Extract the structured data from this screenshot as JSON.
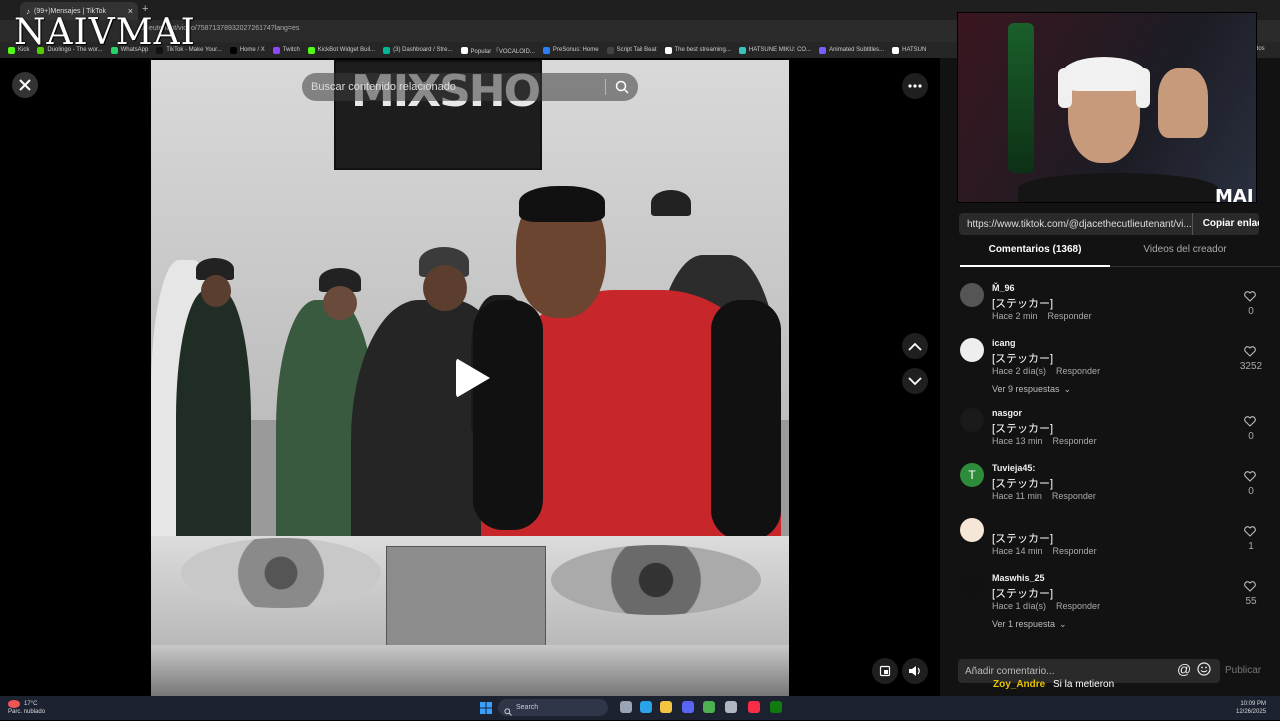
{
  "browser": {
    "tab_title": "(99+)Mensajes | TikTok",
    "new_tab": "+",
    "url": "utlieutenant/video/7587137893202726174?lang=es",
    "bookmarks": [
      {
        "label": "Kick",
        "color": "#53fc18"
      },
      {
        "label": "Duolingo - The wor...",
        "color": "#58cc02"
      },
      {
        "label": "WhatsApp",
        "color": "#25d366"
      },
      {
        "label": "TikTok - Make Your...",
        "color": "#111111"
      },
      {
        "label": "Home / X",
        "color": "#000000"
      },
      {
        "label": "Twitch",
        "color": "#9146ff"
      },
      {
        "label": "KickBot Widget Buil...",
        "color": "#53fc18"
      },
      {
        "label": "(3) Dashboard / Stre...",
        "color": "#00b894"
      },
      {
        "label": "Popular 「VOCALOID...",
        "color": "#ffffff"
      },
      {
        "label": "PreSonus: Home",
        "color": "#2d7ff9"
      },
      {
        "label": "Script Tail Beat",
        "color": "#444444"
      },
      {
        "label": "The best streaming...",
        "color": "#ffffff"
      },
      {
        "label": "HATSUNE MIKU: CO...",
        "color": "#39c5bb"
      },
      {
        "label": "Animated Subtitles...",
        "color": "#7b5cff"
      },
      {
        "label": "HATSUN",
        "color": "#ffffff"
      }
    ],
    "bookmarks_more": "todos"
  },
  "overlay_name": "NAIVMAI",
  "player": {
    "search_placeholder": "Buscar contenido relacionado",
    "sign_text": "MIXSHO",
    "close_icon": "close-icon",
    "more_icon": "more-icon",
    "nav_up_icon": "chevron-up-icon",
    "nav_down_icon": "chevron-down-icon",
    "play_icon": "play-icon"
  },
  "webcam": {
    "brand_text": "MAI"
  },
  "share": {
    "link": "https://www.tiktok.com/@djacethecutlieutenant/vi...",
    "copy_label": "Copiar enlace"
  },
  "tabs": {
    "comments": "Comentarios (1368)",
    "creator_videos": "Videos del creador"
  },
  "comments": [
    {
      "user": "M̌_96",
      "text": "[ステッカー]",
      "time": "Hace 2 min",
      "reply": "Responder",
      "likes": "0",
      "avatar_color": "#555555"
    },
    {
      "user": "icang",
      "text": "[ステッカー]",
      "time": "Hace 2 día(s)",
      "reply": "Responder",
      "likes": "3252",
      "avatar_color": "#eeeeee",
      "replies": "Ver 9 respuestas"
    },
    {
      "user": "nasgor",
      "text": "[ステッカー]",
      "time": "Hace 13 min",
      "reply": "Responder",
      "likes": "0",
      "avatar_color": "#1a1a1a"
    },
    {
      "user": "Tuvieja45:",
      "text": "[ステッカー]",
      "time": "Hace 11 min",
      "reply": "Responder",
      "likes": "0",
      "avatar_color": "#2e8b3a",
      "avatar_letter": "T"
    },
    {
      "user": "",
      "text": "[ステッカー]",
      "time": "Hace 14 min",
      "reply": "Responder",
      "likes": "1",
      "avatar_color": "#f5e6d8"
    },
    {
      "user": "Maswhis_25",
      "text": "[ステッカー]",
      "time": "Hace 1 día(s)",
      "reply": "Responder",
      "likes": "55",
      "avatar_color": "#111111",
      "replies": "Ver 1 respuesta"
    }
  ],
  "compose": {
    "placeholder": "Añadir comentario...",
    "publish": "Publicar"
  },
  "chat_overlay": {
    "user": "Zoy_Andre",
    "message": "Si la metieron",
    "user_color": "#e6c200"
  },
  "taskbar": {
    "temp": "17°C",
    "weather": "Parc. nublado",
    "search": "Search",
    "time": "10:09 PM",
    "date": "12/26/2025"
  }
}
